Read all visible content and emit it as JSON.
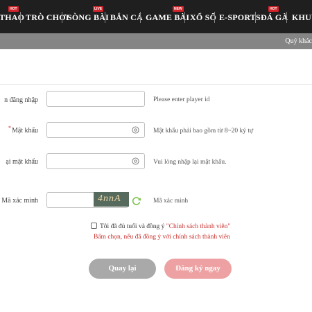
{
  "nav": {
    "items": [
      {
        "label": "THAO"
      },
      {
        "label": "TRÒ CHƠI"
      },
      {
        "label": "SÒNG BÀI"
      },
      {
        "label": "BẮN CÁ"
      },
      {
        "label": "GAME BÀI"
      },
      {
        "label": "XỔ SỐ"
      },
      {
        "label": "E-SPORTS"
      },
      {
        "label": "ĐÁ GÀ"
      },
      {
        "label": "KHUYẾ"
      }
    ],
    "badges": {
      "hot1": "HOT",
      "live": "LIVE",
      "new": "NEW",
      "hot2": "HOT"
    },
    "badge_color": "#d2232a"
  },
  "marquee": "Quý khác",
  "form": {
    "username": {
      "label": "n đăng nhập",
      "colon": ":",
      "hint": "Please enter player id",
      "value": ""
    },
    "password": {
      "required_mark": "*",
      "label": "Mật khẩu",
      "colon": ":",
      "hint": "Mật khẩu phải bao gồm từ 8~20 ký tự",
      "value": ""
    },
    "confirm": {
      "label": "ại mật khẩu",
      "colon": ":",
      "hint": "Vui lòng nhập lại mật khẩu.",
      "value": ""
    },
    "captcha": {
      "label": "Mã xác minh",
      "colon": ":",
      "hint": "Mã xác minh",
      "code": "4nnA",
      "value": ""
    }
  },
  "agreement": {
    "text": "Tôi đã đủ tuổi và đồng ý",
    "policy": "\"Chính sách thành viên\"",
    "warning": "Bấm chọn, nếu đã đồng ý với chính sách thành viên",
    "checked": false
  },
  "buttons": {
    "back": "Quay lại",
    "register": "Đăng ký ngay"
  },
  "colors": {
    "nav_bg": "#1f1f1f",
    "subbar_bg": "#858585",
    "accent_red": "#c9302c",
    "register_btn": "#eda1a3",
    "back_btn": "#a9a9a9"
  }
}
